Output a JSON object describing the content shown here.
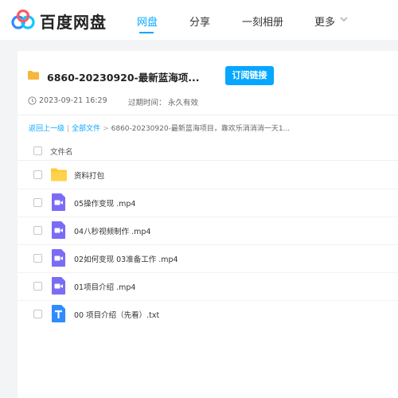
{
  "header": {
    "brand": "百度网盘",
    "nav": [
      "网盘",
      "分享",
      "一刻相册",
      "更多"
    ],
    "active_index": 0,
    "accent": "#06a7ff"
  },
  "share": {
    "title": "6860-20230920-最新蓝海项...",
    "subscribe_label": "订阅链接",
    "time": "2023-09-21 16:29",
    "expire_label": "过期时间：",
    "expire_value": "永久有效"
  },
  "breadcrumb": {
    "back": "返回上一级",
    "sep": "|",
    "all_files": "全部文件",
    "arrow": ">",
    "current": "6860-20230920-最新蓝海项目，靠欢乐消消消一天1..."
  },
  "list": {
    "column_header": "文件名",
    "files": [
      {
        "name": "资料打包",
        "icon": "folder-icon"
      },
      {
        "name": "05操作变现 .mp4",
        "icon": "video-icon"
      },
      {
        "name": "04八秒视频制作 .mp4",
        "icon": "video-icon"
      },
      {
        "name": "02如何变现 03准备工作 .mp4",
        "icon": "video-icon"
      },
      {
        "name": "01项目介绍 .mp4",
        "icon": "video-icon"
      },
      {
        "name": "00 项目介绍（先看）.txt",
        "icon": "text-file-icon"
      }
    ]
  },
  "colors": {
    "folder": "#ffc933",
    "video": "#7b6cf6",
    "txt": "#2f8bff"
  }
}
